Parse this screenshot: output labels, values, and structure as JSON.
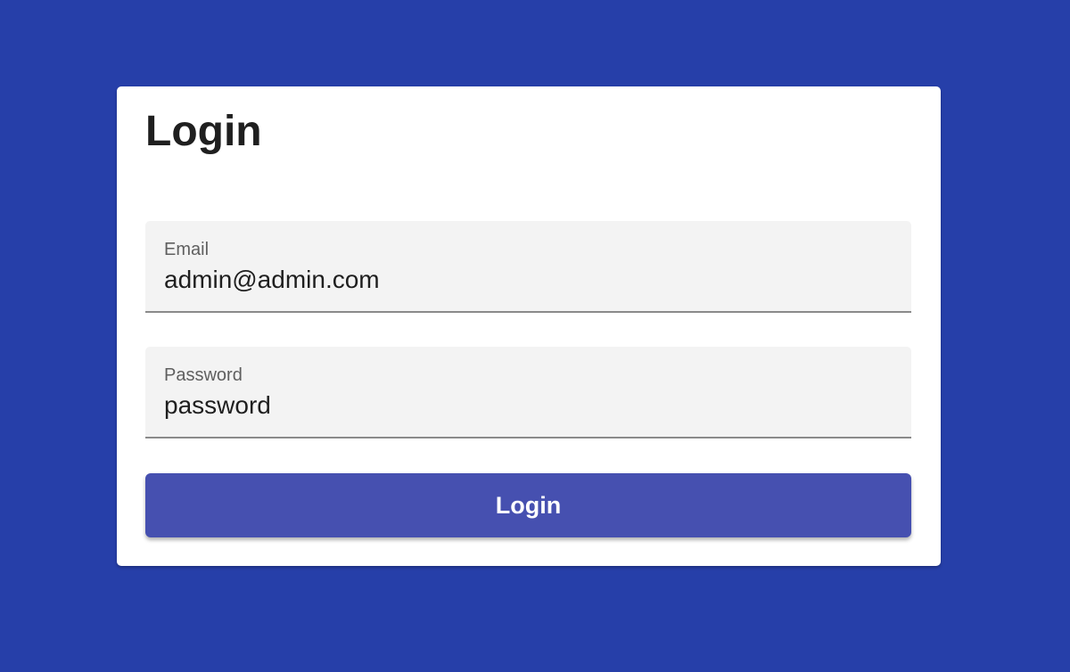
{
  "colors": {
    "background": "#263fa9",
    "card": "#ffffff",
    "field_background": "#f3f3f3",
    "button": "#4650b0"
  },
  "login_form": {
    "title": "Login",
    "email": {
      "label": "Email",
      "value": "admin@admin.com"
    },
    "password": {
      "label": "Password",
      "value": "password"
    },
    "submit_label": "Login"
  }
}
